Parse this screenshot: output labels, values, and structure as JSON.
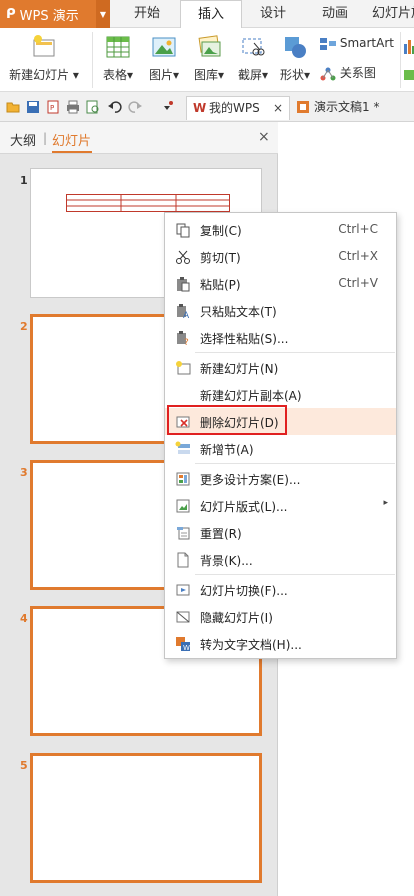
{
  "app": {
    "name": "WPS 演示"
  },
  "tabs": [
    {
      "label": "开始"
    },
    {
      "label": "插入",
      "active": true
    },
    {
      "label": "设计"
    },
    {
      "label": "动画"
    },
    {
      "label": "幻灯片放"
    }
  ],
  "ribbon": {
    "new_slide": "新建幻灯片",
    "table": "表格",
    "image": "图片",
    "gallery": "图库",
    "screenshot": "截屏",
    "shape": "形状",
    "smartart": "SmartArt",
    "relation": "关系图"
  },
  "doc_tabs": [
    {
      "label": "我的WPS",
      "close": "×"
    },
    {
      "label": "演示文稿1 *"
    }
  ],
  "pane": {
    "outline_tab": "大纲",
    "divider": "|",
    "slides_tab": "幻灯片",
    "close": "×"
  },
  "slides": [
    {
      "num": "1"
    },
    {
      "num": "2"
    },
    {
      "num": "3"
    },
    {
      "num": "4"
    },
    {
      "num": "5"
    }
  ],
  "menu": {
    "items": [
      {
        "label": "复制(C)",
        "shortcut": "Ctrl+C"
      },
      {
        "label": "剪切(T)",
        "shortcut": "Ctrl+X"
      },
      {
        "label": "粘贴(P)",
        "shortcut": "Ctrl+V"
      },
      {
        "label": "只粘贴文本(T)"
      },
      {
        "label": "选择性粘贴(S)..."
      },
      {
        "label": "新建幻灯片(N)"
      },
      {
        "label": "新建幻灯片副本(A)"
      },
      {
        "label": "删除幻灯片(D)"
      },
      {
        "label": "新增节(A)"
      },
      {
        "label": "更多设计方案(E)..."
      },
      {
        "label": "幻灯片版式(L)..."
      },
      {
        "label": "重置(R)"
      },
      {
        "label": "背景(K)..."
      },
      {
        "label": "幻灯片切换(F)..."
      },
      {
        "label": "隐藏幻灯片(I)"
      },
      {
        "label": "转为文字文档(H)..."
      }
    ],
    "submenu_arrow": "▸"
  },
  "colors": {
    "accent": "#e07a2e",
    "highlight_border": "#e02020",
    "highlight_bg": "#fde9dc"
  }
}
